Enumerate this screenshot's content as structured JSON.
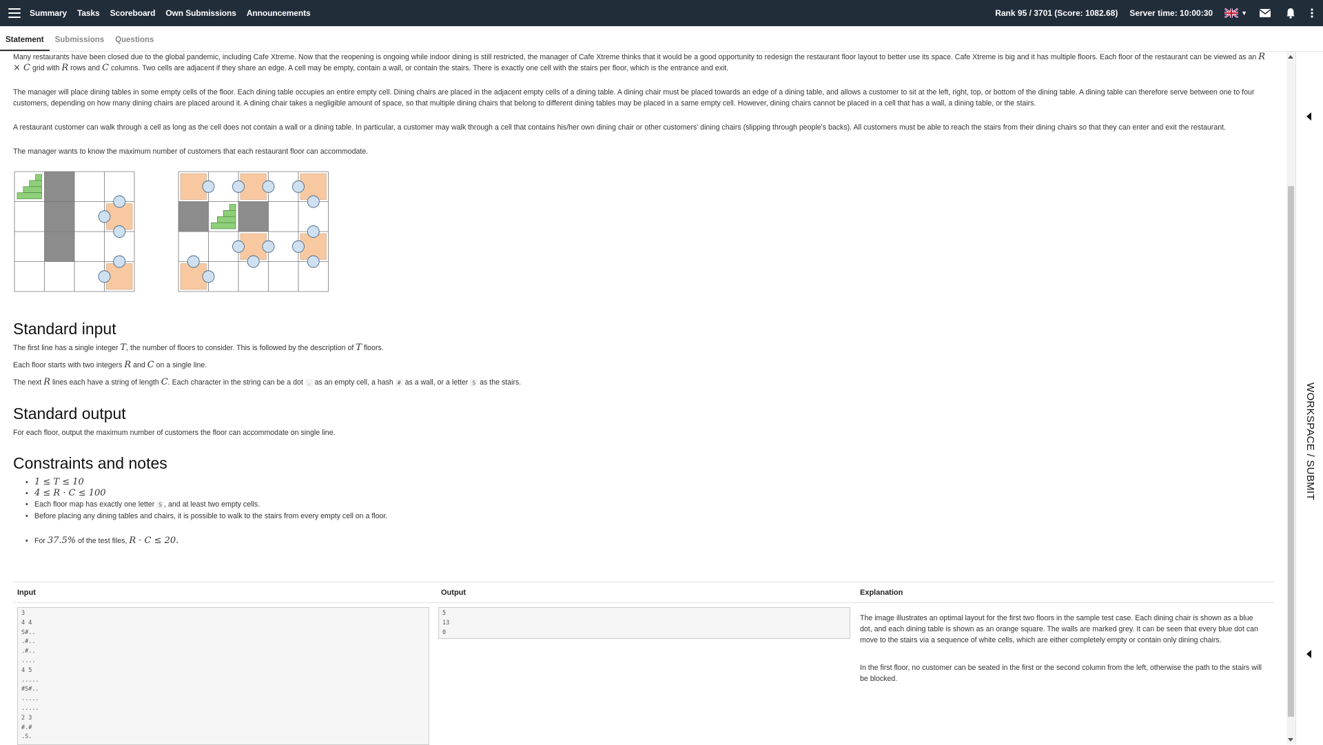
{
  "nav": {
    "links": [
      "Summary",
      "Tasks",
      "Scoreboard",
      "Own Submissions",
      "Announcements"
    ],
    "rank": "Rank 95 / 3701 (Score: 1082.68)",
    "server_time": "Server time: 10:00:30",
    "icons": [
      "uk-flag-icon",
      "envelope-icon",
      "bell-icon",
      "kebab-menu-icon"
    ]
  },
  "subtabs": [
    "Statement",
    "Submissions",
    "Questions"
  ],
  "statement": {
    "p1a": "Many restaurants have been closed due to the global pandemic, including Cafe Xtreme. Now that the reopening is ongoing while indoor dining is still restricted, the manager of Cafe Xtreme thinks that it would be a good opportunity to redesign the restaurant floor layout to better use its space. Cafe Xtreme is big and it has multiple floors. Each floor of the restaurant can be viewed as an",
    "p1_math1": "R × C",
    "p1b": "grid with",
    "p1_math2": "R",
    "p1c": "rows and",
    "p1_math3": "C",
    "p1d": "columns. Two cells are adjacent if they share an edge. A cell may be empty, contain a wall, or contain the stairs. There is exactly one cell with the stairs per floor, which is the entrance and exit.",
    "p2": "The manager will place dining tables in some empty cells of the floor. Each dining table occupies an entire empty cell. Dining chairs are placed in the adjacent empty cells of a dining table. A dining chair must be placed towards an edge of a dining table, and allows a customer to sit at the left, right, top, or bottom of the dining table. A dining table can therefore serve between one to four customers, depending on how many dining chairs are placed around it. A dining chair takes a negligible amount of space, so that multiple dining chairs that belong to different dining tables may be placed in a same empty cell. However, dining chairs cannot be placed in a cell that has a wall, a dining table, or the stairs.",
    "p3": "A restaurant customer can walk through a cell as long as the cell does not contain a wall or a dining table. In particular, a customer may walk through a cell that contains his/her own dining chair or other customers' dining chairs (slipping through people's backs). All customers must be able to reach the stairs from their dining chairs so that they can enter and exit the restaurant.",
    "p4": "The manager wants to know the maximum number of customers that each restaurant floor can accommodate."
  },
  "input_section": {
    "heading": "Standard input",
    "l1a": "The first line has a single integer",
    "l1m": "T",
    "l1b": ", the number of floors to consider. This is followed by the description of",
    "l1m2": "T",
    "l1c": "floors.",
    "l2a": "Each floor starts with two integers",
    "l2m": "R",
    "l2b": "and",
    "l2m2": "C",
    "l2c": "on a single line.",
    "l3a": "The next",
    "l3m": "R",
    "l3b": "lines each have a string of length",
    "l3m2": "C",
    "l3c": ". Each character in the string can be a dot",
    "l3code1": ".",
    "l3d": "as an empty cell, a hash",
    "l3code2": "#",
    "l3e": "as a wall, or a letter",
    "l3code3": "S",
    "l3f": "as the stairs."
  },
  "output_section": {
    "heading": "Standard output",
    "text": "For each floor, output the maximum number of customers the floor can accommodate on single line."
  },
  "constraints": {
    "heading": "Constraints and notes",
    "c1": "1 ≤ T ≤ 10",
    "c2": "4 ≤ R · C ≤ 100",
    "c3a": "Each floor map has exactly one letter",
    "c3code": "S",
    "c3b": ", and at least two empty cells.",
    "c4": "Before placing any dining tables and chairs, it is possible to walk to the stairs from every empty cell on a floor.",
    "c5a": "For",
    "c5m": "37.5%",
    "c5b": "of the test files,",
    "c5m2": "R · C ≤ 20."
  },
  "sample": {
    "headers": [
      "Input",
      "Output",
      "Explanation"
    ],
    "input": "3\n4 4\nS#..\n.#..\n.#..\n....\n4 5\n.....\n#S#..\n.....\n.....\n2 3\n#.#\n.S.",
    "output": "5\n13\n0",
    "expl1": "The image illustrates an optimal layout for the first two floors in the sample test case. Each dining chair is shown as a blue dot, and each dining table is shown as an orange square. The walls are marked grey. It can be seen that every blue dot can move to the stairs via a sequence of white cells, which are either completely empty or contain only dining chairs.",
    "expl2": "In the first floor, no customer can be seated in the first or the second column from the left, otherwise the path to the stairs will be blocked."
  },
  "workspace_label": "WORKSPACE / SUBMIT",
  "colors": {
    "navbar": "#222d3a",
    "wall": "#8c8c8c",
    "table": "#f8c9a0",
    "chair": "#cfe0f0",
    "stairs": "#8fcf7a"
  },
  "grids": [
    {
      "rows": 4,
      "cols": 4,
      "walls": [
        [
          0,
          1
        ],
        [
          1,
          1
        ],
        [
          2,
          1
        ]
      ],
      "stairs": [
        0,
        0
      ],
      "tables": [
        [
          1,
          3
        ],
        [
          3,
          3
        ]
      ],
      "chairs": [
        [
          0,
          3,
          "s"
        ],
        [
          1,
          2,
          "e"
        ],
        [
          1,
          3,
          "s"
        ],
        [
          3,
          3,
          "n"
        ],
        [
          3,
          2,
          "e"
        ]
      ]
    },
    {
      "rows": 4,
      "cols": 5,
      "walls": [
        [
          1,
          0
        ],
        [
          1,
          2
        ]
      ],
      "stairs": [
        1,
        1
      ],
      "tables": [
        [
          0,
          0
        ],
        [
          0,
          2
        ],
        [
          0,
          4
        ],
        [
          2,
          2
        ],
        [
          2,
          4
        ],
        [
          3,
          0
        ]
      ],
      "chairs": [
        [
          0,
          1,
          "w"
        ],
        [
          0,
          1,
          "e"
        ],
        [
          0,
          3,
          "w"
        ],
        [
          0,
          3,
          "e"
        ],
        [
          1,
          4,
          "n"
        ],
        [
          2,
          1,
          "e"
        ],
        [
          2,
          3,
          "w"
        ],
        [
          2,
          3,
          "e"
        ],
        [
          1,
          4,
          "s"
        ],
        [
          3,
          2,
          "n"
        ],
        [
          3,
          4,
          "n"
        ],
        [
          3,
          0,
          "n"
        ],
        [
          3,
          1,
          "w"
        ]
      ]
    }
  ]
}
